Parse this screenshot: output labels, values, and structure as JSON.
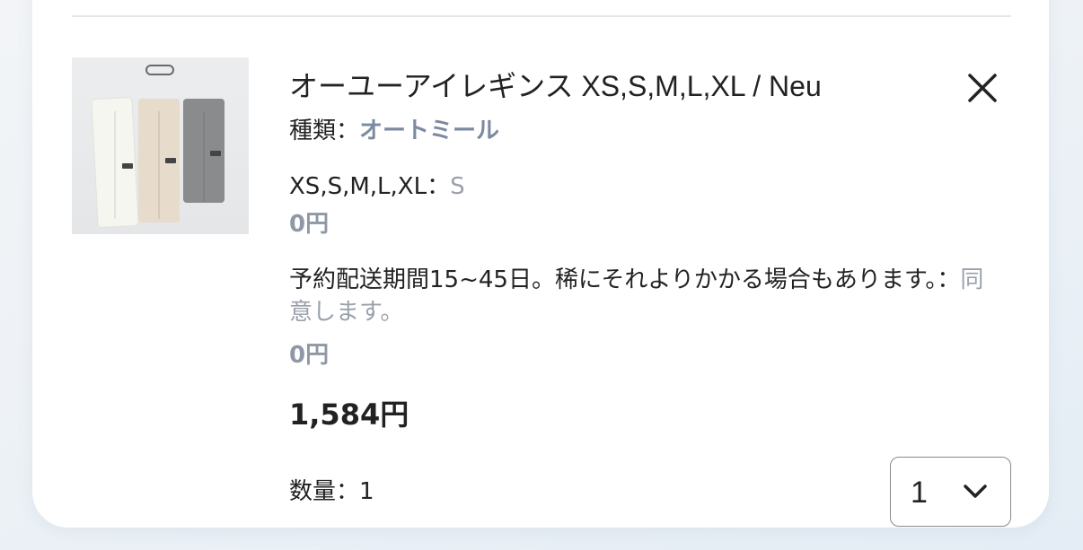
{
  "item": {
    "title": "オーユーアイレギンス XS,S,M,L,XL / Neu",
    "image_alt": "three pairs of leggings",
    "options": [
      {
        "label": "種類：",
        "value": "オートミール"
      },
      {
        "label": "XS,S,M,L,XL：",
        "value": "S",
        "addon_price": "0円"
      },
      {
        "label": "予約配送期間15~45日。稀にそれよりかかる場合もあります。：",
        "value": "同意します。",
        "addon_price": "0円"
      }
    ],
    "price": "1,584円",
    "quantity_label": "数量：1",
    "quantity_select": {
      "selected": "1"
    },
    "icons": {
      "remove": "close-icon",
      "dropdown": "chevron-down-icon"
    }
  },
  "colors": {
    "accent_text": "#7c8aa0",
    "muted_text": "#9aa1ab"
  }
}
